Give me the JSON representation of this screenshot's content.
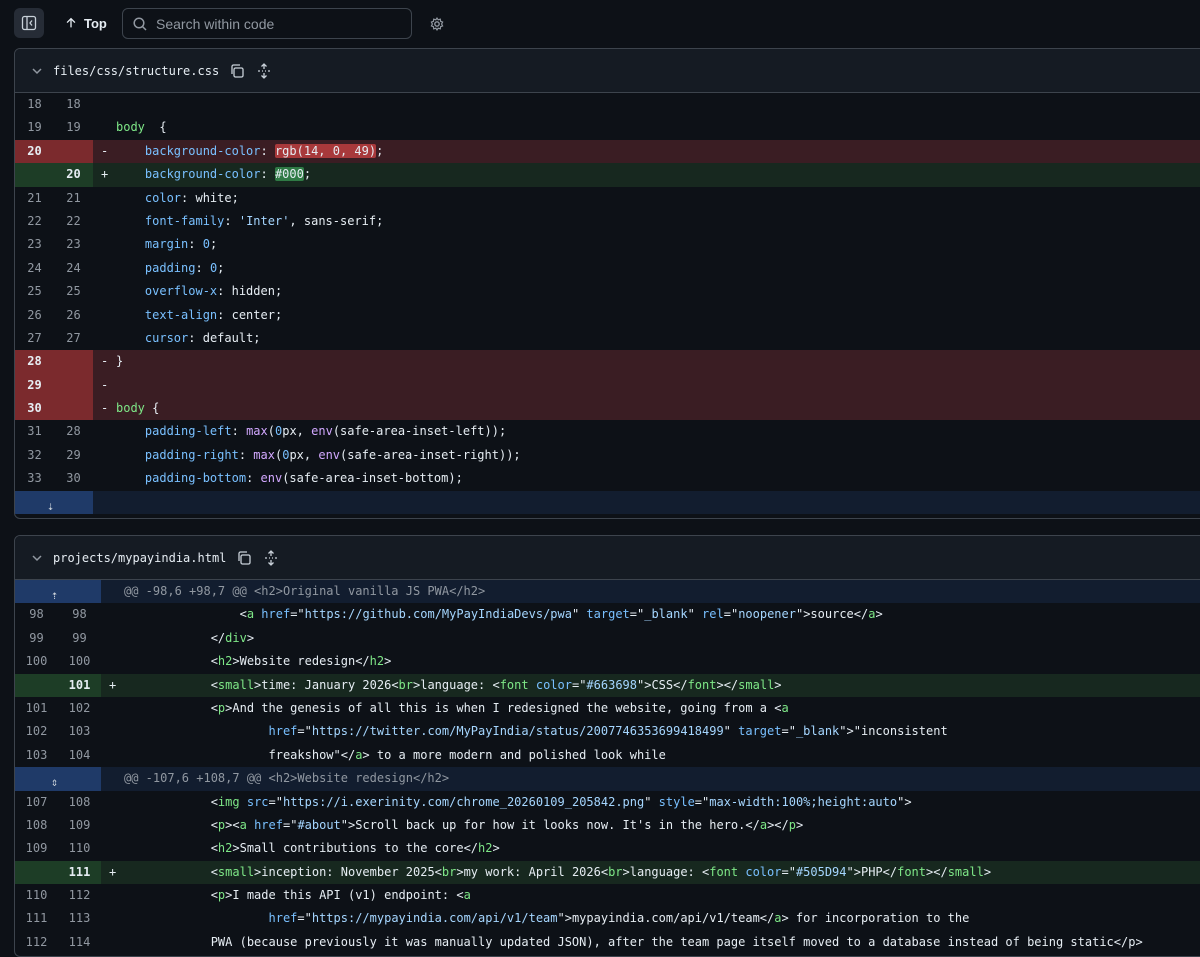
{
  "toolbar": {
    "top_label": "Top",
    "search_placeholder": "Search within code"
  },
  "files": [
    {
      "name": "files/css/structure.css",
      "rows": [
        {
          "type": "ctx",
          "l": "18",
          "r": "18",
          "mark": "",
          "tokens": []
        },
        {
          "type": "ctx",
          "l": "19",
          "r": "19",
          "mark": "",
          "tokens": [
            [
              "t-sel",
              "body"
            ],
            [
              "",
              "  {"
            ]
          ]
        },
        {
          "type": "del",
          "l": "20",
          "r": "",
          "mark": "-",
          "tokens": [
            [
              "",
              "    "
            ],
            [
              "t-prop",
              "background-color"
            ],
            [
              "",
              ": "
            ],
            [
              "hl-del",
              "rgb(14, 0, 49)"
            ],
            [
              "",
              ";"
            ]
          ]
        },
        {
          "type": "add",
          "l": "",
          "r": "20",
          "mark": "+",
          "tokens": [
            [
              "",
              "    "
            ],
            [
              "t-prop",
              "background-color"
            ],
            [
              "",
              ": "
            ],
            [
              "hl-add",
              "#000"
            ],
            [
              "",
              ";"
            ]
          ]
        },
        {
          "type": "ctx",
          "l": "21",
          "r": "21",
          "mark": "",
          "tokens": [
            [
              "",
              "    "
            ],
            [
              "t-prop",
              "color"
            ],
            [
              "",
              ": white;"
            ]
          ]
        },
        {
          "type": "ctx",
          "l": "22",
          "r": "22",
          "mark": "",
          "tokens": [
            [
              "",
              "    "
            ],
            [
              "t-prop",
              "font-family"
            ],
            [
              "",
              ": "
            ],
            [
              "t-str",
              "'Inter'"
            ],
            [
              "",
              ", sans-serif;"
            ]
          ]
        },
        {
          "type": "ctx",
          "l": "23",
          "r": "23",
          "mark": "",
          "tokens": [
            [
              "",
              "    "
            ],
            [
              "t-prop",
              "margin"
            ],
            [
              "",
              ": "
            ],
            [
              "t-num",
              "0"
            ],
            [
              "",
              ";"
            ]
          ]
        },
        {
          "type": "ctx",
          "l": "24",
          "r": "24",
          "mark": "",
          "tokens": [
            [
              "",
              "    "
            ],
            [
              "t-prop",
              "padding"
            ],
            [
              "",
              ": "
            ],
            [
              "t-num",
              "0"
            ],
            [
              "",
              ";"
            ]
          ]
        },
        {
          "type": "ctx",
          "l": "25",
          "r": "25",
          "mark": "",
          "tokens": [
            [
              "",
              "    "
            ],
            [
              "t-prop",
              "overflow-x"
            ],
            [
              "",
              ": hidden;"
            ]
          ]
        },
        {
          "type": "ctx",
          "l": "26",
          "r": "26",
          "mark": "",
          "tokens": [
            [
              "",
              "    "
            ],
            [
              "t-prop",
              "text-align"
            ],
            [
              "",
              ": center;"
            ]
          ]
        },
        {
          "type": "ctx",
          "l": "27",
          "r": "27",
          "mark": "",
          "tokens": [
            [
              "",
              "    "
            ],
            [
              "t-prop",
              "cursor"
            ],
            [
              "",
              ": default;"
            ]
          ]
        },
        {
          "type": "del",
          "l": "28",
          "r": "",
          "mark": "-",
          "tokens": [
            [
              "",
              "}"
            ]
          ]
        },
        {
          "type": "del",
          "l": "29",
          "r": "",
          "mark": "-",
          "tokens": []
        },
        {
          "type": "del",
          "l": "30",
          "r": "",
          "mark": "-",
          "tokens": [
            [
              "t-sel",
              "body"
            ],
            [
              "",
              " {"
            ]
          ]
        },
        {
          "type": "ctx",
          "l": "31",
          "r": "28",
          "mark": "",
          "tokens": [
            [
              "",
              "    "
            ],
            [
              "t-prop",
              "padding-left"
            ],
            [
              "",
              ": "
            ],
            [
              "t-fn",
              "max"
            ],
            [
              "",
              "("
            ],
            [
              "t-num",
              "0"
            ],
            [
              "",
              "px, "
            ],
            [
              "t-fn",
              "env"
            ],
            [
              "",
              "(safe-area-inset-left));"
            ]
          ]
        },
        {
          "type": "ctx",
          "l": "32",
          "r": "29",
          "mark": "",
          "tokens": [
            [
              "",
              "    "
            ],
            [
              "t-prop",
              "padding-right"
            ],
            [
              "",
              ": "
            ],
            [
              "t-fn",
              "max"
            ],
            [
              "",
              "("
            ],
            [
              "t-num",
              "0"
            ],
            [
              "",
              "px, "
            ],
            [
              "t-fn",
              "env"
            ],
            [
              "",
              "(safe-area-inset-right));"
            ]
          ]
        },
        {
          "type": "ctx",
          "l": "33",
          "r": "30",
          "mark": "",
          "tokens": [
            [
              "",
              "    "
            ],
            [
              "t-prop",
              "padding-bottom"
            ],
            [
              "",
              ": "
            ],
            [
              "t-fn",
              "env"
            ],
            [
              "",
              "(safe-area-inset-bottom);"
            ]
          ]
        },
        {
          "type": "hunk",
          "l": "",
          "r": "",
          "mark": "",
          "tokens": []
        }
      ]
    },
    {
      "name": "projects/mypayindia.html",
      "rows": [
        {
          "type": "hunk",
          "l": "",
          "r": "",
          "mark": "",
          "tokens": [
            [
              "",
              "@@ -98,6 +98,7 @@ <h2>Original vanilla JS PWA</h2>"
            ]
          ]
        },
        {
          "type": "ctx",
          "l": "98",
          "r": "98",
          "mark": "",
          "tokens": [
            [
              "",
              "                <"
            ],
            [
              "t-tag",
              "a"
            ],
            [
              "",
              " "
            ],
            [
              "t-attr",
              "href"
            ],
            [
              "",
              "=\""
            ],
            [
              "t-str",
              "https://github.com/MyPayIndiaDevs/pwa"
            ],
            [
              "",
              "\" "
            ],
            [
              "t-attr",
              "target"
            ],
            [
              "",
              "=\""
            ],
            [
              "t-str",
              "_blank"
            ],
            [
              "",
              "\" "
            ],
            [
              "t-attr",
              "rel"
            ],
            [
              "",
              "=\""
            ],
            [
              "t-str",
              "noopener"
            ],
            [
              "",
              "\">source</"
            ],
            [
              "t-tag",
              "a"
            ],
            [
              "",
              ">"
            ]
          ]
        },
        {
          "type": "ctx",
          "l": "99",
          "r": "99",
          "mark": "",
          "tokens": [
            [
              "",
              "            </"
            ],
            [
              "t-tag",
              "div"
            ],
            [
              "",
              ">"
            ]
          ]
        },
        {
          "type": "ctx",
          "l": "100",
          "r": "100",
          "mark": "",
          "tokens": [
            [
              "",
              "            <"
            ],
            [
              "t-tag",
              "h2"
            ],
            [
              "",
              ">Website redesign</"
            ],
            [
              "t-tag",
              "h2"
            ],
            [
              "",
              ">"
            ]
          ]
        },
        {
          "type": "add",
          "l": "",
          "r": "101",
          "mark": "+",
          "tokens": [
            [
              "",
              "            <"
            ],
            [
              "t-tag",
              "small"
            ],
            [
              "",
              ">time: January 2026<"
            ],
            [
              "t-tag",
              "br"
            ],
            [
              "",
              ">language: <"
            ],
            [
              "t-tag",
              "font"
            ],
            [
              "",
              " "
            ],
            [
              "t-attr",
              "color"
            ],
            [
              "",
              "=\""
            ],
            [
              "t-str",
              "#663698"
            ],
            [
              "",
              "\">CSS</"
            ],
            [
              "t-tag",
              "font"
            ],
            [
              "",
              "></"
            ],
            [
              "t-tag",
              "small"
            ],
            [
              "",
              ">"
            ]
          ]
        },
        {
          "type": "ctx",
          "l": "101",
          "r": "102",
          "mark": "",
          "tokens": [
            [
              "",
              "            <"
            ],
            [
              "t-tag",
              "p"
            ],
            [
              "",
              ">And the genesis of all this is when I redesigned the website, going from a <"
            ],
            [
              "t-tag",
              "a"
            ]
          ]
        },
        {
          "type": "ctx",
          "l": "102",
          "r": "103",
          "mark": "",
          "tokens": [
            [
              "",
              "                    "
            ],
            [
              "t-attr",
              "href"
            ],
            [
              "",
              "=\""
            ],
            [
              "t-str",
              "https://twitter.com/MyPayIndia/status/2007746353699418499"
            ],
            [
              "",
              "\" "
            ],
            [
              "t-attr",
              "target"
            ],
            [
              "",
              "=\""
            ],
            [
              "t-str",
              "_blank"
            ],
            [
              "",
              "\">\"inconsistent"
            ]
          ]
        },
        {
          "type": "ctx",
          "l": "103",
          "r": "104",
          "mark": "",
          "tokens": [
            [
              "",
              "                    freakshow\"</"
            ],
            [
              "t-tag",
              "a"
            ],
            [
              "",
              "> to a more modern and polished look while"
            ]
          ]
        },
        {
          "type": "hunk",
          "l": "",
          "r": "",
          "mark": "",
          "tokens": [
            [
              "",
              "@@ -107,6 +108,7 @@ <h2>Website redesign</h2>"
            ]
          ]
        },
        {
          "type": "ctx",
          "l": "107",
          "r": "108",
          "mark": "",
          "tokens": [
            [
              "",
              "            <"
            ],
            [
              "t-tag",
              "img"
            ],
            [
              "",
              " "
            ],
            [
              "t-attr",
              "src"
            ],
            [
              "",
              "=\""
            ],
            [
              "t-str",
              "https://i.exerinity.com/chrome_20260109_205842.png"
            ],
            [
              "",
              "\" "
            ],
            [
              "t-attr",
              "style"
            ],
            [
              "",
              "=\""
            ],
            [
              "t-str",
              "max-width:100%;height:auto"
            ],
            [
              "",
              "\">"
            ]
          ]
        },
        {
          "type": "ctx",
          "l": "108",
          "r": "109",
          "mark": "",
          "tokens": [
            [
              "",
              "            <"
            ],
            [
              "t-tag",
              "p"
            ],
            [
              "",
              "><"
            ],
            [
              "t-tag",
              "a"
            ],
            [
              "",
              " "
            ],
            [
              "t-attr",
              "href"
            ],
            [
              "",
              "=\""
            ],
            [
              "t-str",
              "#about"
            ],
            [
              "",
              "\">Scroll back up for how it looks now. It's in the hero.</"
            ],
            [
              "t-tag",
              "a"
            ],
            [
              "",
              "></"
            ],
            [
              "t-tag",
              "p"
            ],
            [
              "",
              ">"
            ]
          ]
        },
        {
          "type": "ctx",
          "l": "109",
          "r": "110",
          "mark": "",
          "tokens": [
            [
              "",
              "            <"
            ],
            [
              "t-tag",
              "h2"
            ],
            [
              "",
              ">Small contributions to the core</"
            ],
            [
              "t-tag",
              "h2"
            ],
            [
              "",
              ">"
            ]
          ]
        },
        {
          "type": "add",
          "l": "",
          "r": "111",
          "mark": "+",
          "tokens": [
            [
              "",
              "            <"
            ],
            [
              "t-tag",
              "small"
            ],
            [
              "",
              ">inception: November 2025<"
            ],
            [
              "t-tag",
              "br"
            ],
            [
              "",
              ">my work: April 2026<"
            ],
            [
              "t-tag",
              "br"
            ],
            [
              "",
              ">language: <"
            ],
            [
              "t-tag",
              "font"
            ],
            [
              "",
              " "
            ],
            [
              "t-attr",
              "color"
            ],
            [
              "",
              "=\""
            ],
            [
              "t-str",
              "#505D94"
            ],
            [
              "",
              "\">PHP</"
            ],
            [
              "t-tag",
              "font"
            ],
            [
              "",
              "></"
            ],
            [
              "t-tag",
              "small"
            ],
            [
              "",
              ">"
            ]
          ]
        },
        {
          "type": "ctx",
          "l": "110",
          "r": "112",
          "mark": "",
          "tokens": [
            [
              "",
              "            <"
            ],
            [
              "t-tag",
              "p"
            ],
            [
              "",
              ">I made this API (v1) endpoint: <"
            ],
            [
              "t-tag",
              "a"
            ]
          ]
        },
        {
          "type": "ctx",
          "l": "111",
          "r": "113",
          "mark": "",
          "tokens": [
            [
              "",
              "                    "
            ],
            [
              "t-attr",
              "href"
            ],
            [
              "",
              "=\""
            ],
            [
              "t-str",
              "https://mypayindia.com/api/v1/team"
            ],
            [
              "",
              "\">mypayindia.com/api/v1/team</"
            ],
            [
              "t-tag",
              "a"
            ],
            [
              "",
              "> for incorporation to the"
            ]
          ]
        },
        {
          "type": "ctx",
          "l": "112",
          "r": "114",
          "mark": "",
          "tokens": [
            [
              "",
              "            PWA (because previously it was manually updated JSON), after the team page itself moved to a database instead of being static</p>"
            ]
          ]
        }
      ]
    }
  ]
}
